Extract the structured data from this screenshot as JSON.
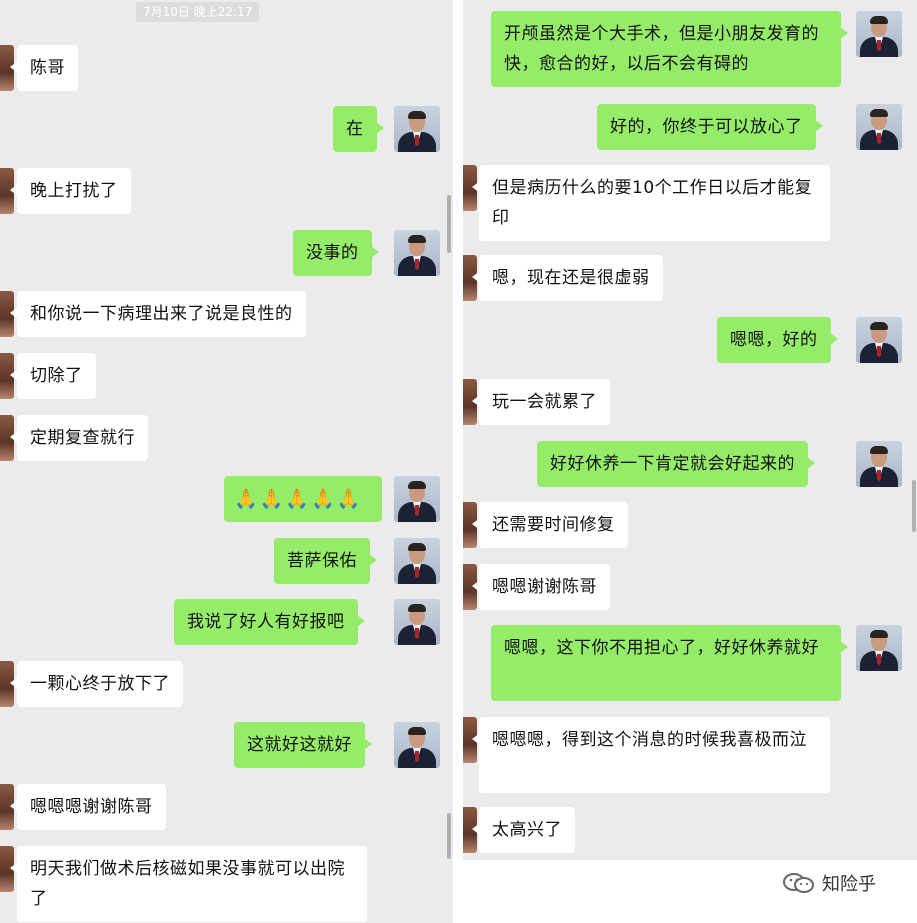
{
  "left": {
    "timestamp": "7月10日 晚上22:17",
    "messages": [
      {
        "dir": "in",
        "text": "陈哥"
      },
      {
        "dir": "out",
        "text": "在"
      },
      {
        "dir": "in",
        "text": "晚上打扰了"
      },
      {
        "dir": "out",
        "text": "没事的"
      },
      {
        "dir": "in",
        "text": "和你说一下病理出来了说是良性的"
      },
      {
        "dir": "in",
        "text": "切除了"
      },
      {
        "dir": "in",
        "text": "定期复查就行"
      },
      {
        "dir": "out",
        "text": "🙏🙏🙏🙏🙏"
      },
      {
        "dir": "out",
        "text": "菩萨保佑"
      },
      {
        "dir": "out",
        "text": "我说了好人有好报吧"
      },
      {
        "dir": "in",
        "text": "一颗心终于放下了"
      },
      {
        "dir": "out",
        "text": "这就好这就好"
      },
      {
        "dir": "in",
        "text": "嗯嗯嗯谢谢陈哥"
      },
      {
        "dir": "in",
        "text": "明天我们做术后核磁如果没事就可以出院了"
      }
    ]
  },
  "right": {
    "messages": [
      {
        "dir": "out",
        "text": "开颅虽然是个大手术，但是小朋友发育的快，愈合的好，以后不会有碍的"
      },
      {
        "dir": "out",
        "text": "好的，你终于可以放心了"
      },
      {
        "dir": "in",
        "text": "但是病历什么的要10个工作日以后才能复印"
      },
      {
        "dir": "in",
        "text": "嗯，现在还是很虚弱"
      },
      {
        "dir": "out",
        "text": "嗯嗯，好的"
      },
      {
        "dir": "in",
        "text": "玩一会就累了"
      },
      {
        "dir": "out",
        "text": "好好休养一下肯定就会好起来的"
      },
      {
        "dir": "in",
        "text": "还需要时间修复"
      },
      {
        "dir": "in",
        "text": "嗯嗯谢谢陈哥"
      },
      {
        "dir": "out",
        "text": "嗯嗯，这下你不用担心了，好好休养就好"
      },
      {
        "dir": "in",
        "text": "嗯嗯嗯，得到这个消息的时候我喜极而泣"
      },
      {
        "dir": "in",
        "text": "太高兴了"
      }
    ]
  },
  "watermark": {
    "text": "知险乎",
    "icon": "wechat-official-account-icon"
  },
  "colors": {
    "sent_bubble": "#95ec69",
    "received_bubble": "#ffffff",
    "background": "#ebebeb"
  }
}
